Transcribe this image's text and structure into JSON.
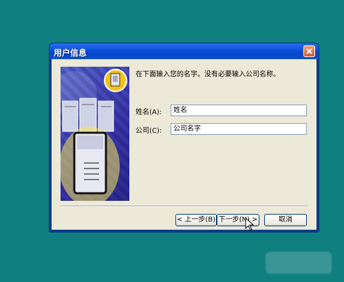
{
  "dialog": {
    "title": "用户信息",
    "instruction": "在下面输入您的名字。没有必要输入公司名称。",
    "name_label": "姓名(A):",
    "name_value": "姓名",
    "company_label": "公司(C):",
    "company_value": "公司名字",
    "back_label": "< 上一步(B)",
    "next_label": "下一步(N) >",
    "cancel_label": "取消"
  },
  "colors": {
    "desktop": "#0f7f7f",
    "titlebar": "#0b4fd8",
    "dialog_face": "#ece9d8",
    "close_button": "#d05a32"
  },
  "icons": [
    "close-icon",
    "server-illustration",
    "document-icon",
    "mouse-cursor-icon"
  ]
}
